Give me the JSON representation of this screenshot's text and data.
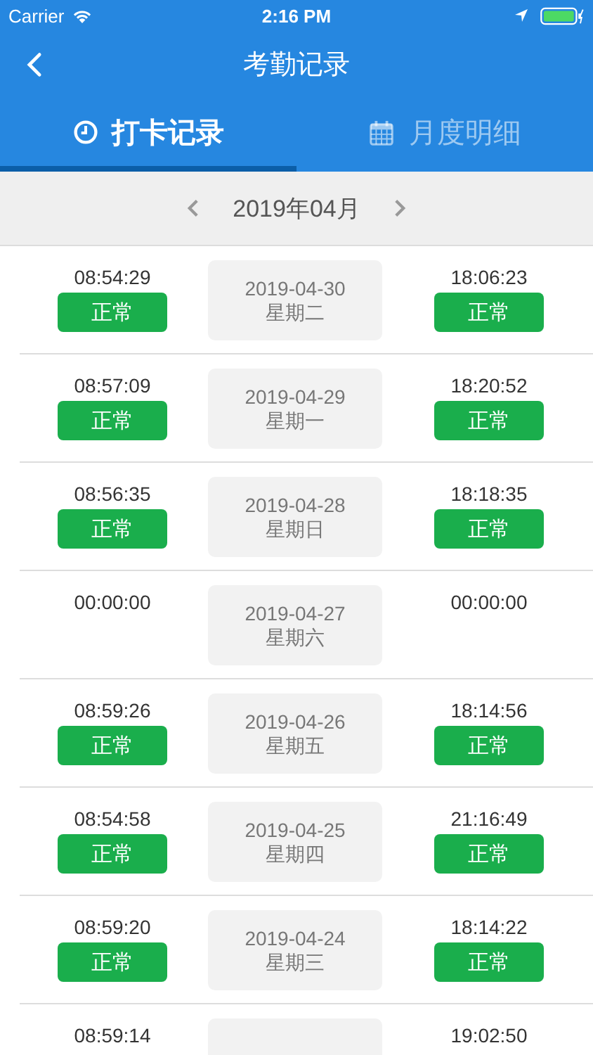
{
  "status_bar": {
    "carrier": "Carrier",
    "time": "2:16 PM"
  },
  "nav": {
    "title": "考勤记录"
  },
  "tabs": [
    {
      "label": "打卡记录",
      "kind": "clock",
      "selected": true
    },
    {
      "label": "月度明细",
      "kind": "calendar",
      "selected": false
    }
  ],
  "month": {
    "label": "2019年04月"
  },
  "records": [
    {
      "in_time": "08:54:29",
      "in_status": "正常",
      "date": "2019-04-30",
      "weekday": "星期二",
      "out_time": "18:06:23",
      "out_status": "正常"
    },
    {
      "in_time": "08:57:09",
      "in_status": "正常",
      "date": "2019-04-29",
      "weekday": "星期一",
      "out_time": "18:20:52",
      "out_status": "正常"
    },
    {
      "in_time": "08:56:35",
      "in_status": "正常",
      "date": "2019-04-28",
      "weekday": "星期日",
      "out_time": "18:18:35",
      "out_status": "正常"
    },
    {
      "in_time": "00:00:00",
      "date": "2019-04-27",
      "weekday": "星期六",
      "out_time": "00:00:00"
    },
    {
      "in_time": "08:59:26",
      "in_status": "正常",
      "date": "2019-04-26",
      "weekday": "星期五",
      "out_time": "18:14:56",
      "out_status": "正常"
    },
    {
      "in_time": "08:54:58",
      "in_status": "正常",
      "date": "2019-04-25",
      "weekday": "星期四",
      "out_time": "21:16:49",
      "out_status": "正常"
    },
    {
      "in_time": "08:59:20",
      "in_status": "正常",
      "date": "2019-04-24",
      "weekday": "星期三",
      "out_time": "18:14:22",
      "out_status": "正常"
    },
    {
      "in_time": "08:59:14",
      "out_time": "19:02:50"
    }
  ]
}
